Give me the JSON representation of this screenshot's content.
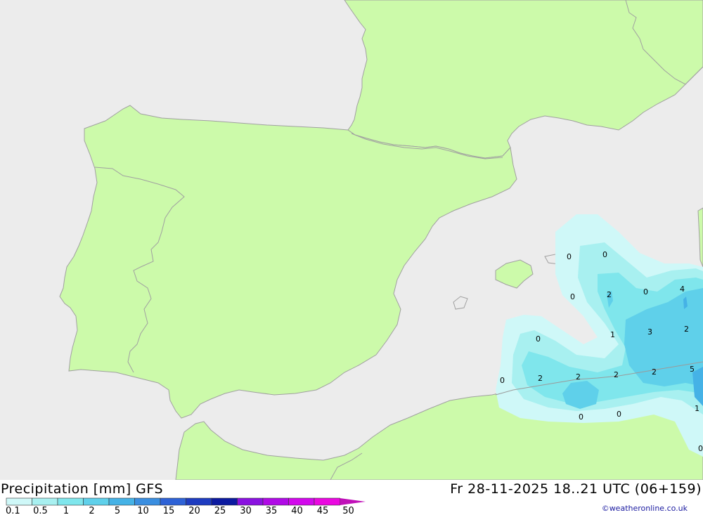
{
  "header": {
    "product": "Precipitation [mm] GFS",
    "valid_time": "Fr 28-11-2025 18..21 UTC (06+159)",
    "credit": "©weatheronline.co.uk"
  },
  "legend": {
    "labels": [
      "0.1",
      "0.5",
      "1",
      "2",
      "5",
      "10",
      "15",
      "20",
      "25",
      "30",
      "35",
      "40",
      "45",
      "50"
    ],
    "colors": [
      "#cff8f8",
      "#a8f0f0",
      "#7fe6ec",
      "#5fd0ea",
      "#45b2e6",
      "#3a8ee0",
      "#2e62d6",
      "#1e3cc0",
      "#0c1aa0",
      "#8a12e0",
      "#b00ae6",
      "#d208ec",
      "#ea08e0",
      "#c010b8"
    ]
  },
  "map": {
    "colors": {
      "sea": "#ececec",
      "land": "#ccfaaa",
      "border": "#a0a0a0"
    },
    "values": [
      {
        "text": "0"
      },
      {
        "text": "0"
      },
      {
        "text": "0"
      },
      {
        "text": "2"
      },
      {
        "text": "0"
      },
      {
        "text": "4"
      },
      {
        "text": "1"
      },
      {
        "text": "3"
      },
      {
        "text": "2"
      },
      {
        "text": "0"
      },
      {
        "text": "0"
      },
      {
        "text": "2"
      },
      {
        "text": "2"
      },
      {
        "text": "2"
      },
      {
        "text": "2"
      },
      {
        "text": "5"
      },
      {
        "text": "1"
      },
      {
        "text": "0"
      },
      {
        "text": "0"
      },
      {
        "text": "0"
      }
    ]
  }
}
